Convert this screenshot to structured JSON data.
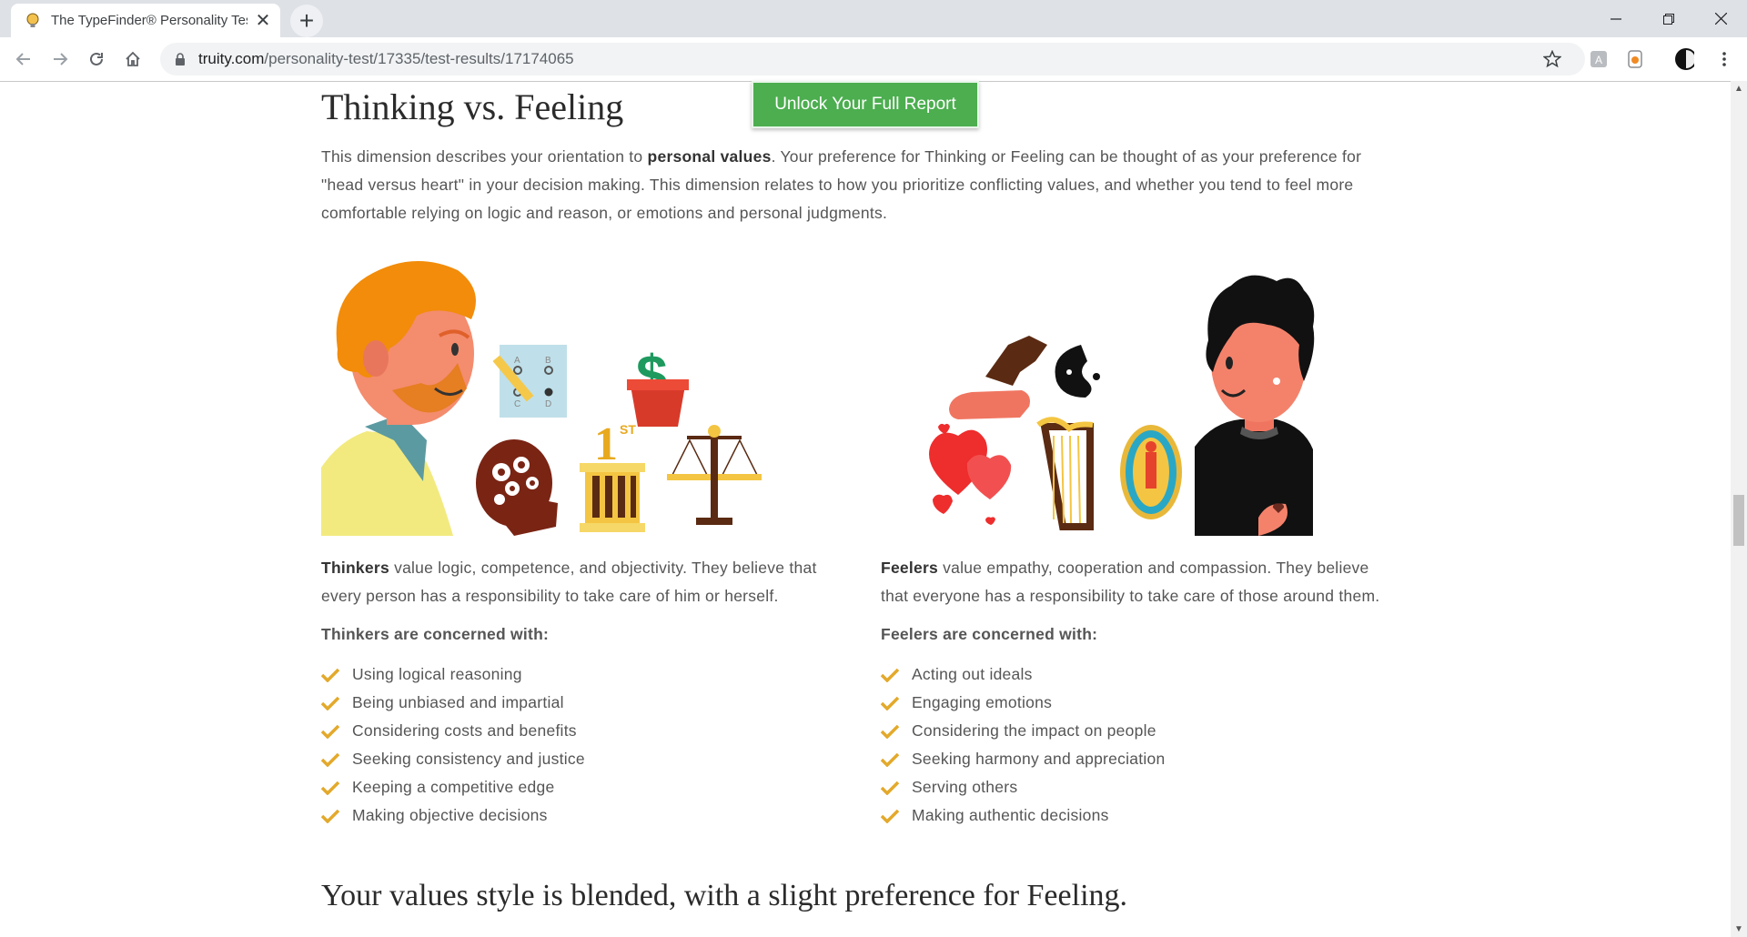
{
  "browser": {
    "tab_title": "The TypeFinder® Personality Test",
    "url_domain": "truity.com",
    "url_path": "/personality-test/17335/test-results/17174065"
  },
  "page": {
    "section_title": "Thinking vs. Feeling",
    "unlock_button": "Unlock Your Full Report",
    "intro_part1": "This dimension describes your orientation to ",
    "intro_bold": "personal values",
    "intro_part2": ". Your preference for Thinking or Feeling can be thought of as your preference for \"head versus heart\" in your decision making. This dimension relates to how you prioritize conflicting values, and whether you tend to feel more comfortable relying on logic and reason, or emotions and personal judgments.",
    "thinkers": {
      "lead": "Thinkers",
      "desc": " value logic, competence, and objectivity. They believe that every person has a responsibility to take care of him or herself.",
      "concern_title": "Thinkers are concerned with:",
      "items": [
        "Using logical reasoning",
        "Being unbiased and impartial",
        "Considering costs and benefits",
        "Seeking consistency and justice",
        "Keeping a competitive edge",
        "Making objective decisions"
      ]
    },
    "feelers": {
      "lead": "Feelers",
      "desc": " value empathy, cooperation and compassion. They believe that everyone has a responsibility to take care of those around them.",
      "concern_title": "Feelers are concerned with:",
      "items": [
        "Acting out ideals",
        "Engaging emotions",
        "Considering the impact on people",
        "Seeking harmony and appreciation",
        "Serving others",
        "Making authentic decisions"
      ]
    },
    "result_heading": "Your values style is blended, with a slight preference for Feeling."
  },
  "colors": {
    "unlock_green": "#4cae4f",
    "check_gold": "#e3a92b",
    "text_gray": "#555555"
  }
}
